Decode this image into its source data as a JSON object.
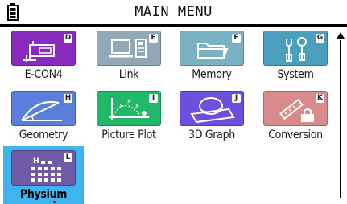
{
  "header": {
    "title": "MAIN MENU"
  },
  "menu": {
    "items": [
      {
        "label": "E-CON4",
        "key": "D",
        "color": "#8a2bbf",
        "icon": "econ-sensor-icon"
      },
      {
        "label": "Link",
        "key": "E",
        "color": "#93a8b6",
        "icon": "link-computer-icon"
      },
      {
        "label": "Memory",
        "key": "F",
        "color": "#7bb2c3",
        "icon": "memory-folder-icon"
      },
      {
        "label": "System",
        "key": "G",
        "color": "#4aa0bc",
        "icon": "system-tools-icon"
      },
      {
        "label": "Geometry",
        "key": "H",
        "color": "#5a7edb",
        "icon": "geometry-icon"
      },
      {
        "label": "Picture Plot",
        "key": "I",
        "color": "#22b86a",
        "icon": "picture-plot-icon"
      },
      {
        "label": "3D Graph",
        "key": "J",
        "color": "#6d4fe0",
        "icon": "3d-graph-icon"
      },
      {
        "label": "Conversion",
        "key": "K",
        "color": "#d98a8a",
        "icon": "conversion-icon"
      },
      {
        "label": "Physium",
        "key": "L",
        "color": "#6f5aa8",
        "icon": "physium-icon",
        "selected": true
      }
    ]
  }
}
